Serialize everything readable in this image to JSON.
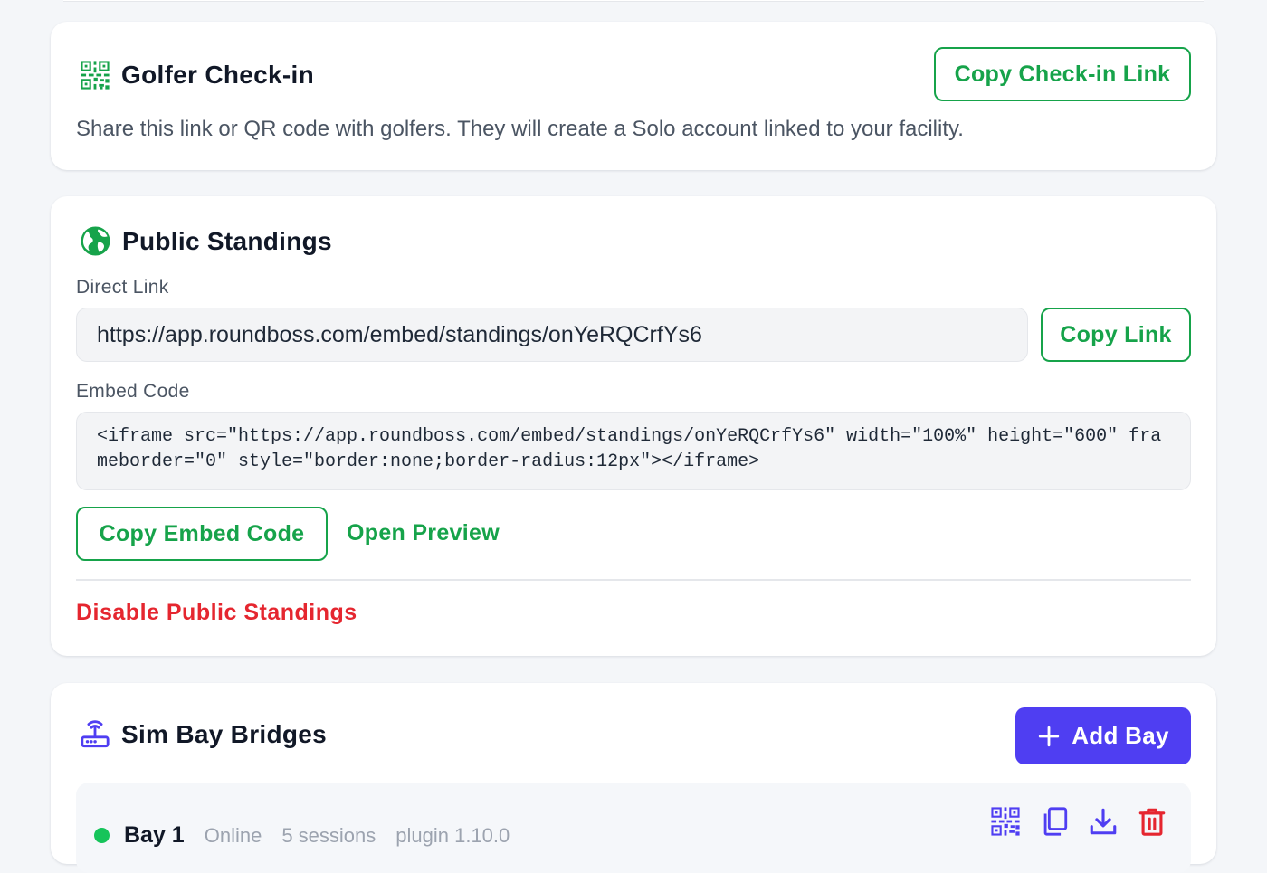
{
  "checkin": {
    "title": "Golfer Check-in",
    "copy_button": "Copy Check-in Link",
    "description": "Share this link or QR code with golfers. They will create a Solo account linked to your facility."
  },
  "standings": {
    "title": "Public Standings",
    "direct_link_label": "Direct Link",
    "direct_link_value": "https://app.roundboss.com/embed/standings/onYeRQCrfYs6",
    "copy_link_button": "Copy Link",
    "embed_code_label": "Embed Code",
    "embed_code_value": "<iframe src=\"https://app.roundboss.com/embed/standings/onYeRQCrfYs6\" width=\"100%\" height=\"600\" frameborder=\"0\" style=\"border:none;border-radius:12px\"></iframe>",
    "copy_embed_button": "Copy Embed Code",
    "open_preview_link": "Open Preview",
    "disable_link": "Disable Public Standings"
  },
  "bays": {
    "title": "Sim Bay Bridges",
    "add_button": "Add Bay",
    "items": [
      {
        "name": "Bay 1",
        "status": "Online",
        "sessions": "5 sessions",
        "plugin": "plugin 1.10.0",
        "status_color": "#16c45a"
      }
    ]
  },
  "colors": {
    "accent_green": "#16a34a",
    "primary_purple": "#4f3ef2",
    "danger_red": "#e5262f"
  },
  "icons": {
    "checkin": "qr-code-icon",
    "standings": "globe-icon",
    "bays": "router-icon",
    "bay_actions": [
      "qr-code-icon",
      "copy-icon",
      "download-icon",
      "trash-icon"
    ]
  }
}
